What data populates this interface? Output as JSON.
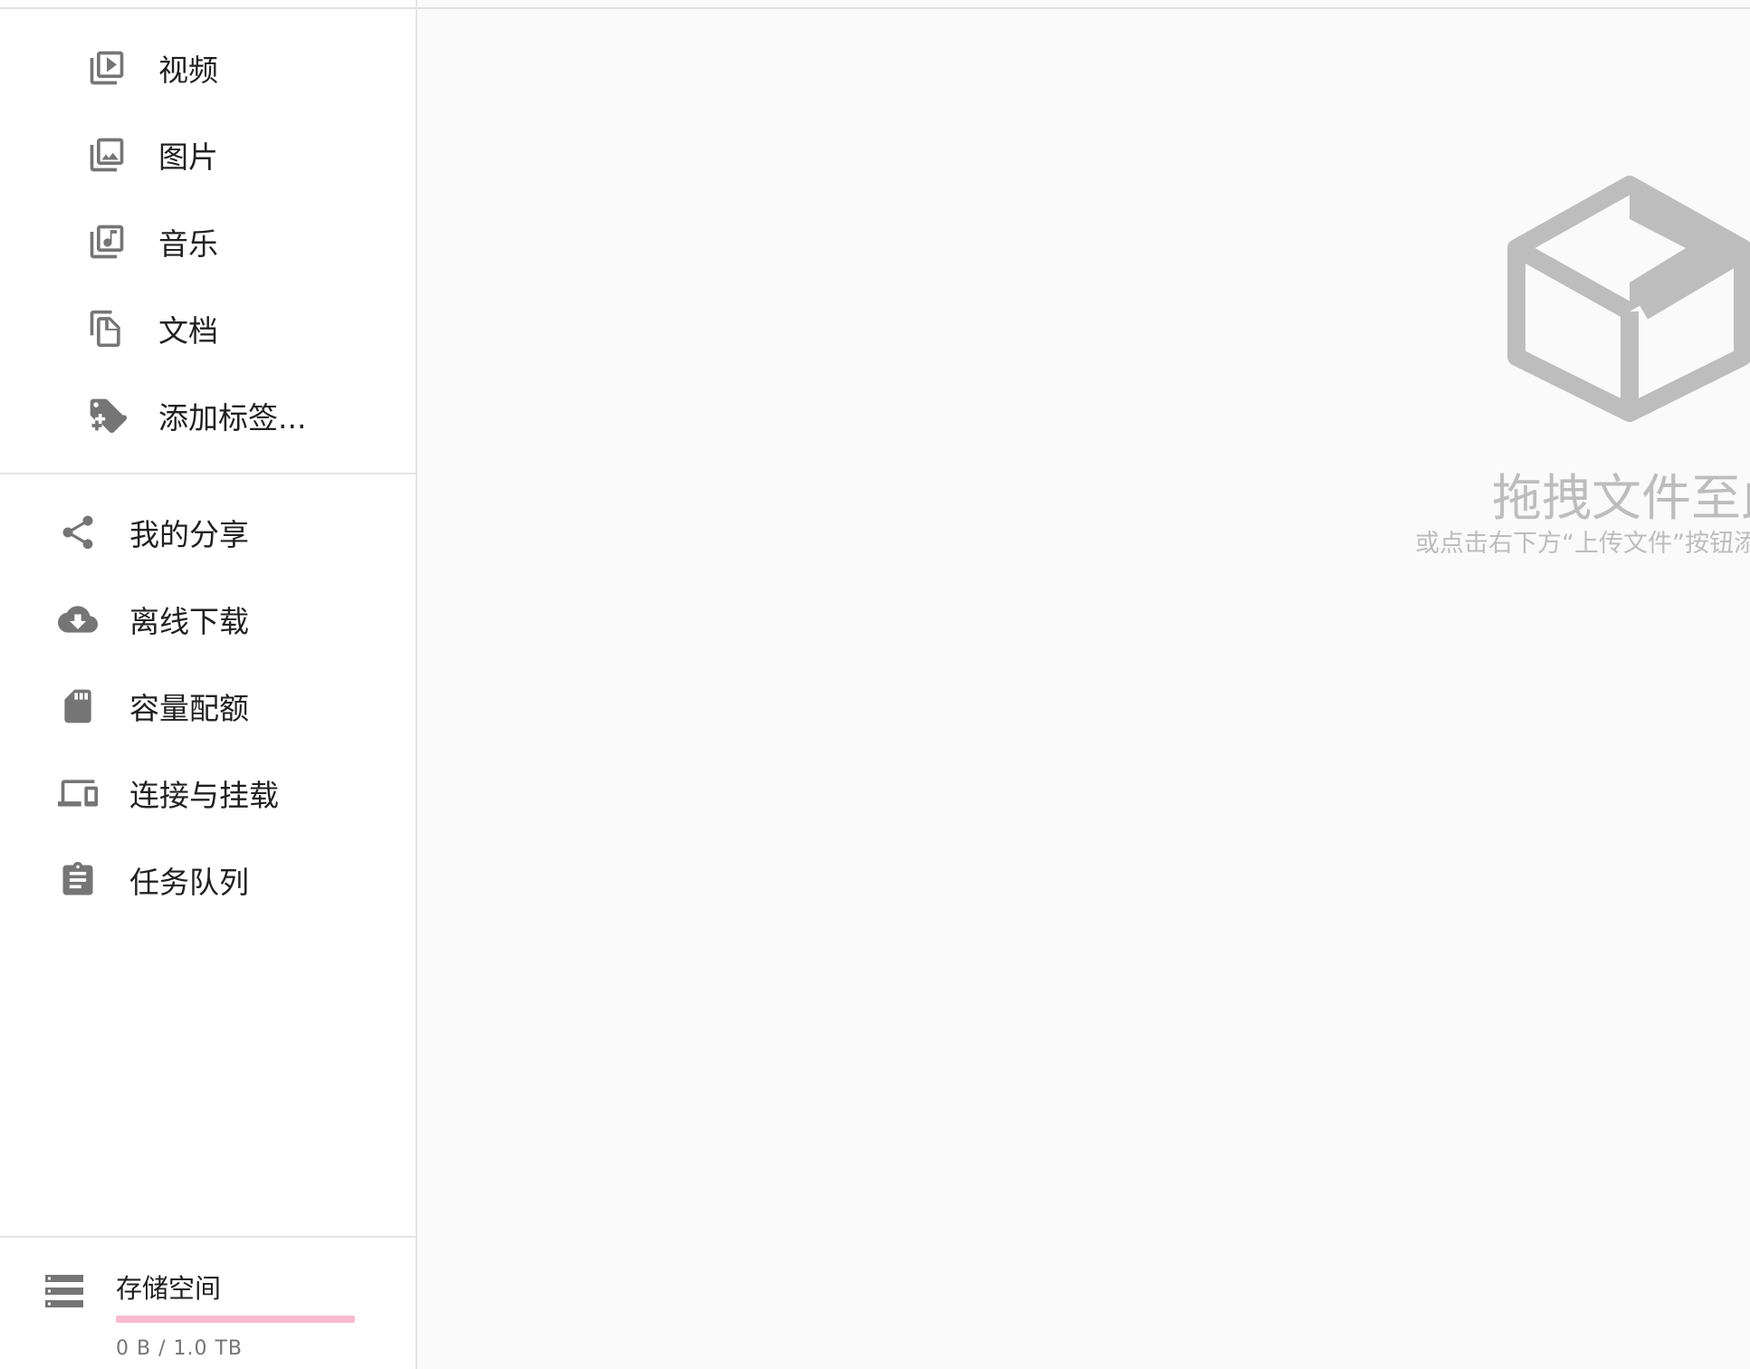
{
  "sidebar": {
    "file_types": [
      {
        "label": "视频",
        "icon": "video-library-icon"
      },
      {
        "label": "图片",
        "icon": "photo-library-icon"
      },
      {
        "label": "音乐",
        "icon": "music-library-icon"
      },
      {
        "label": "文档",
        "icon": "documents-icon"
      },
      {
        "label": "添加标签...",
        "icon": "add-tag-icon"
      }
    ],
    "items": [
      {
        "label": "我的分享",
        "icon": "share-icon"
      },
      {
        "label": "离线下载",
        "icon": "cloud-download-icon"
      },
      {
        "label": "容量配额",
        "icon": "sd-card-icon"
      },
      {
        "label": "连接与挂载",
        "icon": "devices-icon"
      },
      {
        "label": "任务队列",
        "icon": "assignment-icon"
      }
    ],
    "storage": {
      "title": "存储空间",
      "usage": "0 B / 1.0 TB",
      "used_fraction": 0.0,
      "icon": "storage-icon",
      "bar_color": "#f48fb1"
    }
  },
  "main": {
    "empty_state": {
      "icon": "box-icon",
      "title": "拖拽文件至此",
      "subtitle": "或点击右下方“上传文件”按钮添加文件"
    }
  },
  "colors": {
    "icon": "#757575",
    "empty_state": "#bdbdbd",
    "background": "#fafafa"
  }
}
